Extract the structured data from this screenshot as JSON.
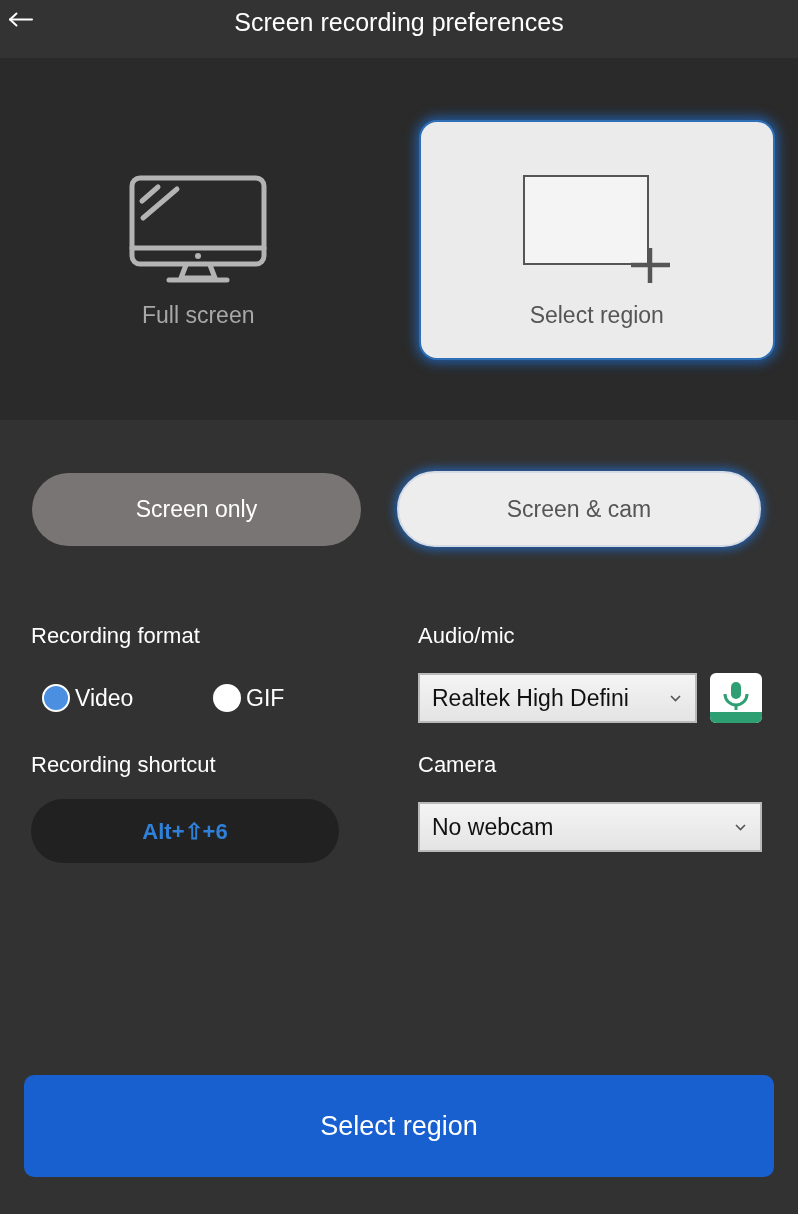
{
  "header": {
    "title": "Screen recording preferences"
  },
  "capture_modes": [
    {
      "kind": "full_screen",
      "label": "Full screen",
      "selected": false
    },
    {
      "kind": "region",
      "label": "Select region",
      "selected": true
    }
  ],
  "source_modes": [
    {
      "label": "Screen only",
      "selected": false
    },
    {
      "label": "Screen & cam",
      "selected": true
    }
  ],
  "recording_format": {
    "label": "Recording format",
    "options": [
      {
        "label": "Video",
        "selected": true
      },
      {
        "label": "GIF",
        "selected": false
      }
    ]
  },
  "recording_shortcut": {
    "label": "Recording shortcut",
    "value": "Alt+⇧+6"
  },
  "audio_mic": {
    "label": "Audio/mic",
    "value": "Realtek High Defini"
  },
  "camera": {
    "label": "Camera",
    "value": "No webcam"
  },
  "primary_button": {
    "label": "Select region"
  }
}
